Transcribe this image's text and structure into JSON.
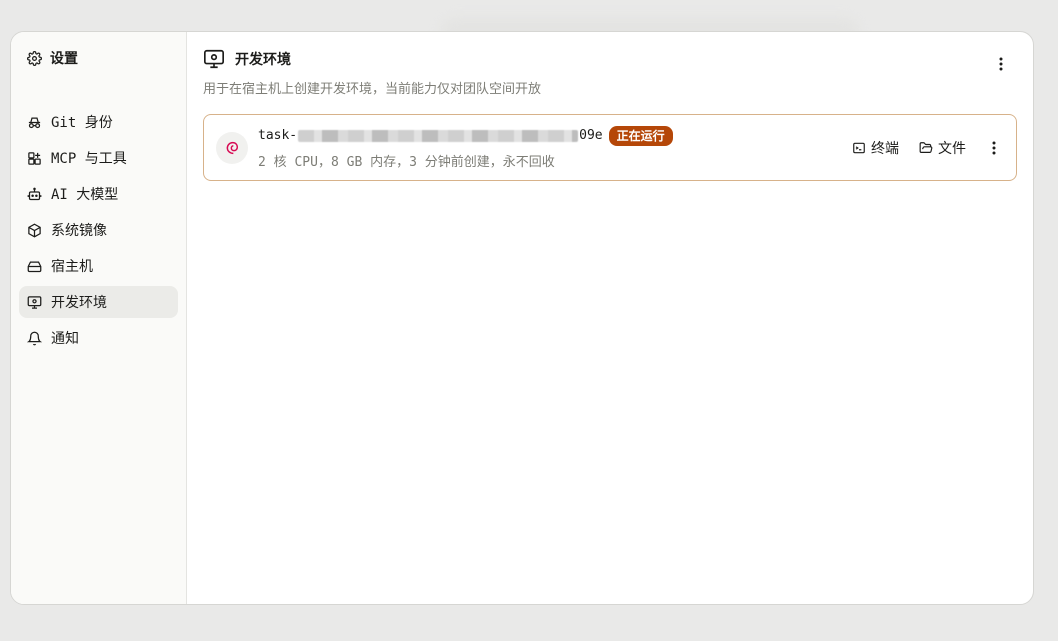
{
  "sidebar": {
    "title": "设置",
    "items": [
      {
        "label": "Git 身份",
        "icon": "incognito-icon"
      },
      {
        "label": "MCP 与工具",
        "icon": "puzzle-icon"
      },
      {
        "label": "AI 大模型",
        "icon": "robot-icon"
      },
      {
        "label": "系统镜像",
        "icon": "cube-icon"
      },
      {
        "label": "宿主机",
        "icon": "hard-drive-icon"
      },
      {
        "label": "开发环境",
        "icon": "monitor-icon",
        "active": true
      },
      {
        "label": "通知",
        "icon": "bell-icon"
      }
    ]
  },
  "main": {
    "title": "开发环境",
    "subtitle": "用于在宿主机上创建开发环境，当前能力仅对团队空间开放",
    "environment": {
      "name_prefix": "task-",
      "name_suffix": "09e",
      "status": "正在运行",
      "meta": "2 核 CPU，8 GB 内存，3 分钟前创建，永不回收",
      "os_icon": "debian-icon",
      "actions": {
        "terminal": "终端",
        "files": "文件"
      }
    }
  },
  "colors": {
    "status_badge": "#b54708",
    "card_border": "#d7b28a",
    "active_item": "#ebebe8"
  }
}
